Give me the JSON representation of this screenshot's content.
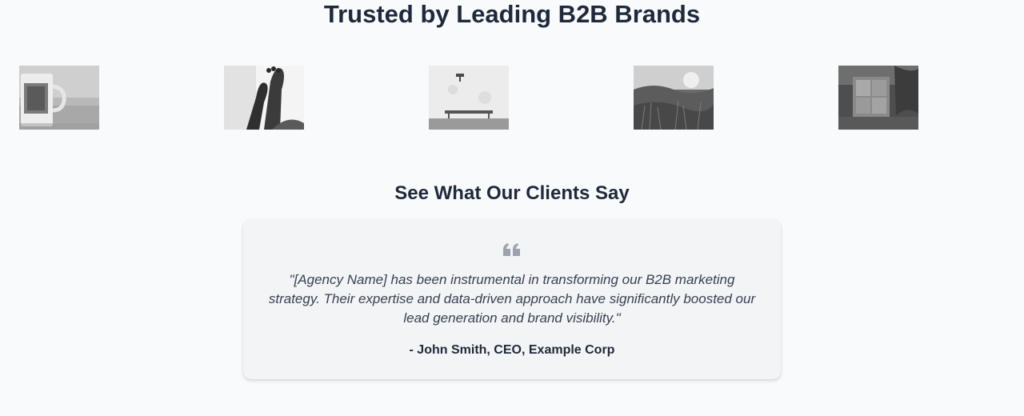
{
  "brands": {
    "title": "Trusted by Leading B2B Brands",
    "logos": [
      {
        "name": "mug-photo-logo"
      },
      {
        "name": "feet-photo-logo"
      },
      {
        "name": "bench-photo-logo"
      },
      {
        "name": "field-photo-logo"
      },
      {
        "name": "window-photo-logo"
      }
    ]
  },
  "testimonials": {
    "title": "See What Our Clients Say",
    "icon": "quote-left-icon",
    "quote": "\"[Agency Name] has been instrumental in transforming our B2B marketing strategy. Their expertise and data-driven approach have significantly boosted our lead generation and brand visibility.\"",
    "author": "- John Smith, CEO, Example Corp"
  },
  "colors": {
    "background": "#f9fafb",
    "heading": "#1e293b",
    "card": "#f3f4f6",
    "quote_icon": "#9ca3af"
  }
}
